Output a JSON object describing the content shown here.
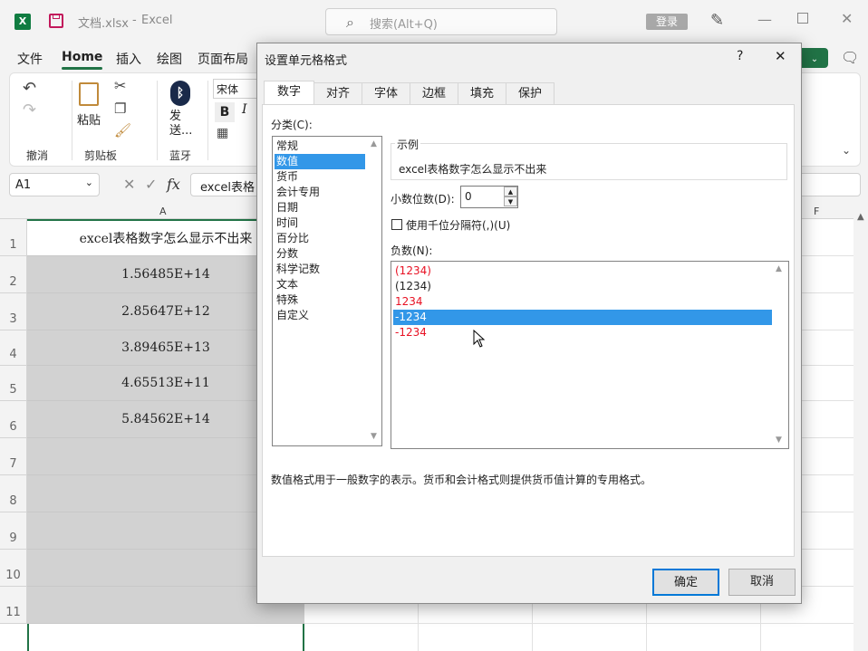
{
  "titlebar": {
    "filename": "文档.xlsx",
    "separator": "-",
    "app": "Excel",
    "search_placeholder": "搜索(Alt+Q)",
    "login": "登录"
  },
  "ribbon_tabs": [
    "文件",
    "Home",
    "插入",
    "绘图",
    "页面布局"
  ],
  "ribbon": {
    "paste_label": "粘贴",
    "send_label": "发送...",
    "font_name": "宋体",
    "bold": "B",
    "italic": "I",
    "groups": [
      "撤消",
      "剪贴板",
      "蓝牙"
    ]
  },
  "formula_bar": {
    "name_box": "A1",
    "fx": "fx",
    "formula": "excel表格"
  },
  "grid": {
    "col_a": "A",
    "col_f": "F",
    "rows": [
      "1",
      "2",
      "3",
      "4",
      "5",
      "6",
      "7",
      "8",
      "9",
      "10",
      "11"
    ],
    "cells": [
      "excel表格数字怎么显示不出来",
      "1.56485E+14",
      "2.85647E+12",
      "3.89465E+13",
      "4.65513E+11",
      "5.84562E+14"
    ]
  },
  "dialog": {
    "title": "设置单元格格式",
    "help": "?",
    "close": "✕",
    "tabs": [
      "数字",
      "对齐",
      "字体",
      "边框",
      "填充",
      "保护"
    ],
    "category_label": "分类(C):",
    "categories": [
      "常规",
      "数值",
      "货币",
      "会计专用",
      "日期",
      "时间",
      "百分比",
      "分数",
      "科学记数",
      "文本",
      "特殊",
      "自定义"
    ],
    "selected_category": "数值",
    "sample_label": "示例",
    "sample_value": "excel表格数字怎么显示不出来",
    "decimal_label": "小数位数(D):",
    "decimal_value": "0",
    "thousands_label": "使用千位分隔符(,)(U)",
    "negative_label": "负数(N):",
    "negatives": [
      {
        "text": "(1234)",
        "color": "#e81123"
      },
      {
        "text": "(1234)",
        "color": "#222222"
      },
      {
        "text": "1234",
        "color": "#e81123"
      },
      {
        "text": "-1234",
        "color": "#ffffff"
      },
      {
        "text": "-1234",
        "color": "#e81123"
      }
    ],
    "selected_negative": "-1234",
    "description": "数值格式用于一般数字的表示。货币和会计格式则提供货币值计算的专用格式。",
    "ok": "确定",
    "cancel": "取消"
  },
  "colors": {
    "excel_green": "#217346",
    "selection_blue": "#3297e8",
    "negative_red": "#e81123"
  }
}
